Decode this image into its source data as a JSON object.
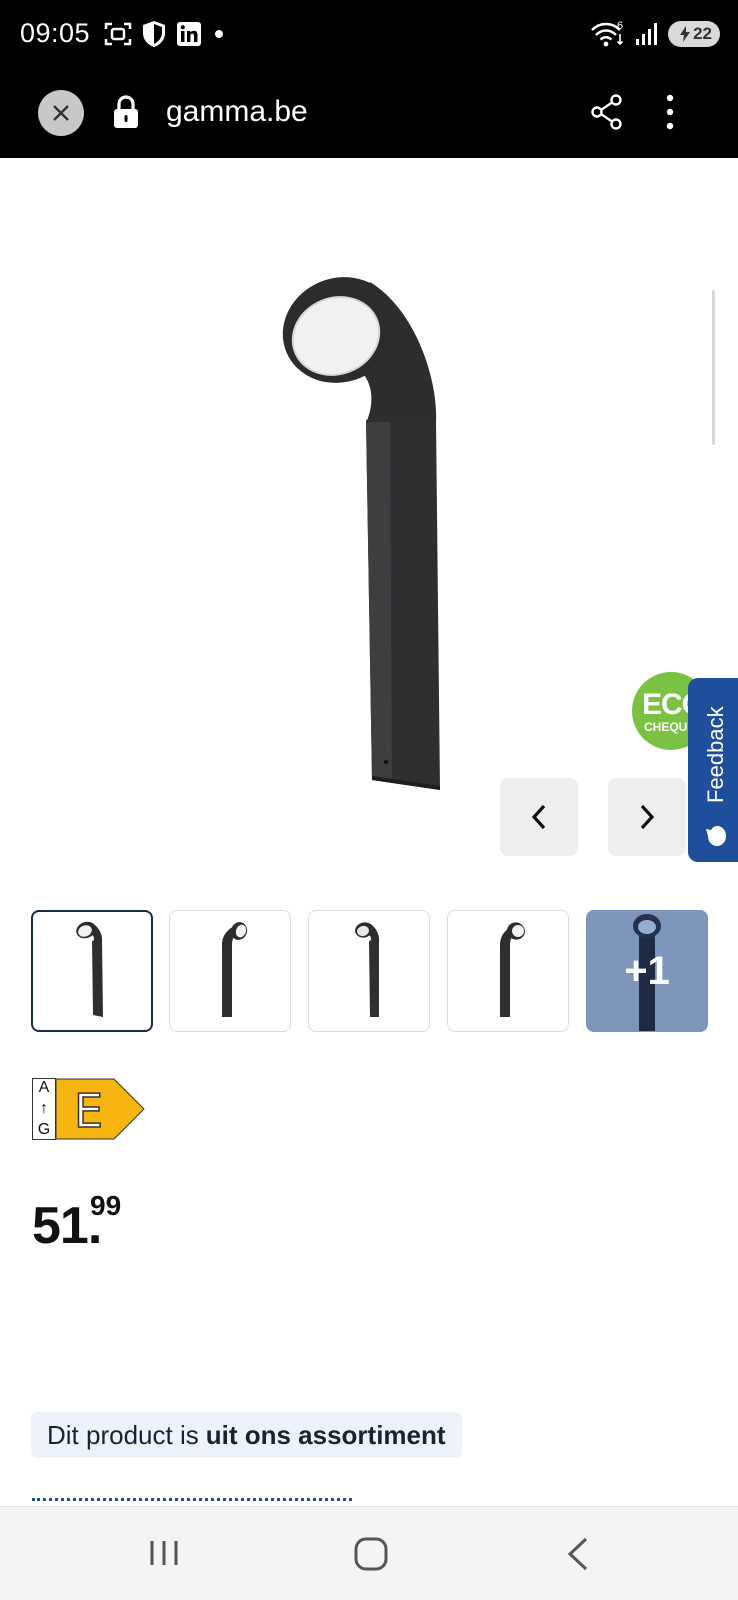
{
  "status_bar": {
    "time": "09:05",
    "wifi_badge": "6",
    "battery_level": "22",
    "icons": [
      "screenshot-icon",
      "shield-icon",
      "linkedin-icon",
      "notification-dot-icon",
      "wifi-icon",
      "signal-icon",
      "battery-icon"
    ]
  },
  "browser": {
    "url": "gamma.be",
    "icons": [
      "close-icon",
      "lock-icon",
      "share-icon",
      "more-vert-icon"
    ]
  },
  "product": {
    "eco_badge_title": "ECO",
    "eco_badge_sub": "CHEQUE",
    "feedback_label": "Feedback",
    "thumbnails_count": 4,
    "more_label": "+1",
    "energy_scale_top": "A",
    "energy_scale_arrow": "↑",
    "energy_scale_bottom": "G",
    "energy_class": "E",
    "price_int": "51",
    "price_dec": "99",
    "notice_prefix": "Dit product is",
    "notice_bold": "uit ons assortiment"
  },
  "colors": {
    "brand_blue": "#1f4e9c",
    "eco_green": "#7cc242",
    "energy_yellow": "#f6b511",
    "notice_bg": "#eef3fb"
  }
}
